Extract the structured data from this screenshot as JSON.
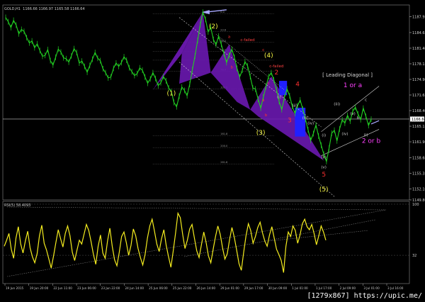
{
  "chart_data": [
    {
      "type": "line",
      "title": "GOLD,H1",
      "header_values": "1166.66 1166.97 1165.58 1166.64",
      "ylim": [
        1149.8,
        1190.4
      ],
      "y_ticks": [
        1187.95,
        1184.65,
        1181.4,
        1178.15,
        1174.9,
        1171.65,
        1168.4,
        1165.15,
        1161.9,
        1158.6,
        1155.35,
        1152.1,
        1149.8
      ],
      "current_price": "1166.64",
      "x_ticks": [
        "19 Jun 2015",
        "19 Jun 20:00",
        "22 Jun 11:00",
        "23 Jun 06:00",
        "23 Jun 22:00",
        "24 Jun 14:00",
        "25 Jun 06:00",
        "25 Jun 22:00",
        "26 Jun 14:00",
        "29 Jun 01:00",
        "29 Jun 17:00",
        "30 Jun 09:00",
        "1 Jul 01:00",
        "1 Jul 17:00",
        "2 Jul 09:00",
        "3 Jul 01:00",
        "3 Jul 16:00"
      ],
      "series": [
        {
          "values": [
            1187.8,
            1186.9,
            1185.7,
            1187.2,
            1186.2,
            1184.4,
            1185.3,
            1184.9,
            1183.6,
            1182.5,
            1182.9,
            1181.5,
            1182.3,
            1180.9,
            1179.7,
            1179.9,
            1181.1,
            1178.8,
            1177.9,
            1179.5,
            1181.2,
            1180.6,
            1179.4,
            1179.2,
            1178.5,
            1179.8,
            1181.3,
            1180.5,
            1178.3,
            1178.7,
            1177.6,
            1176.4,
            1177.8,
            1179.1,
            1180.5,
            1179.3,
            1178.8,
            1177.1,
            1176.3,
            1175.2,
            1175.4,
            1177.2,
            1178.3,
            1177.6,
            1178.4,
            1179.6,
            1178.9,
            1177.3,
            1176.5,
            1175.7,
            1176.1,
            1177.3,
            1176.8,
            1175.4,
            1174.1,
            1175.0,
            1176.3,
            1175.1,
            1173.6,
            1174.2,
            1175.5,
            1174.6,
            1173.1,
            1172.4,
            1170.1,
            1169.2,
            1171.4,
            1173.3,
            1172.6,
            1171.5,
            1173.9,
            1176.9,
            1179.8,
            1183.0,
            1186.3,
            1188.9,
            1187.4,
            1184.8,
            1185.7,
            1183.2,
            1182.1,
            1183.9,
            1182.2,
            1180.3,
            1178.4,
            1179.9,
            1181.2,
            1179.5,
            1177.2,
            1175.4,
            1176.8,
            1178.6,
            1177.7,
            1175.5,
            1173.1,
            1172.9,
            1170.8,
            1168.9,
            1171.2,
            1173.4,
            1175.5,
            1176.3,
            1174.8,
            1172.7,
            1170.3,
            1168.6,
            1171.1,
            1172.9,
            1171.5,
            1169.3,
            1167.8,
            1169.4,
            1170.6,
            1168.7,
            1166.6,
            1164.4,
            1162.2,
            1163.6,
            1165.4,
            1163.1,
            1161.2,
            1159.3,
            1157.8,
            1160.6,
            1163.7,
            1164.3,
            1162.1,
            1164.6,
            1166.5,
            1165.8,
            1167.4,
            1166.2,
            1168.3,
            1169.1,
            1167.7,
            1166.5,
            1168.9,
            1167.2,
            1165.3,
            1166.6
          ],
          "color": "#22d022"
        }
      ],
      "annotations": [
        {
          "text": "(2)",
          "color": "#f5f542",
          "x": 79,
          "y": 1185.5
        },
        {
          "text": "(1)",
          "color": "#f5f542",
          "x": 63,
          "y": 1171.6
        },
        {
          "text": "(3)",
          "color": "#f5f542",
          "x": 97,
          "y": 1163.4
        },
        {
          "text": "(4)",
          "color": "#f5f542",
          "x": 100,
          "y": 1179.5
        },
        {
          "text": "(5)",
          "color": "#f5f542",
          "x": 121,
          "y": 1151.6
        },
        {
          "text": "2",
          "color": "#ff3030",
          "x": 103,
          "y": 1175.9
        },
        {
          "text": "3",
          "color": "#ff3030",
          "x": 108,
          "y": 1166.0
        },
        {
          "text": "4",
          "color": "#ff3030",
          "x": 111,
          "y": 1173.5
        },
        {
          "text": "5",
          "color": "#ff3030",
          "x": 121,
          "y": 1154.7
        },
        {
          "text": "c-failed",
          "color": "#ff4040",
          "x": 92,
          "y": 1182.9
        },
        {
          "text": "c-failed",
          "color": "#ff4040",
          "x": 103,
          "y": 1177.4
        },
        {
          "text": "[ Leading Diagonal ]",
          "color": "#d8d8d8",
          "x": 130,
          "y": 1175.5
        },
        {
          "text": "1 or a",
          "color": "#ff40ff",
          "x": 132,
          "y": 1173.3
        },
        {
          "text": "2 or b",
          "color": "#ff40ff",
          "x": 139,
          "y": 1161.7
        },
        {
          "text": "a",
          "color": "#ff3030",
          "x": 85,
          "y": 1183.5
        },
        {
          "text": "b",
          "color": "#ff3030",
          "x": 86,
          "y": 1177.2
        },
        {
          "text": "c",
          "color": "#ff3030",
          "x": 98,
          "y": 1180.8
        },
        {
          "text": "a",
          "color": "#ff3030",
          "x": 98,
          "y": 1170.3
        },
        {
          "text": "b",
          "color": "#ff3030",
          "x": 99,
          "y": 1167.2
        },
        {
          "text": "c",
          "color": "#ff3030",
          "x": 100,
          "y": 1173.9
        },
        {
          "text": "(i)",
          "color": "#cfcfcf",
          "x": 104,
          "y": 1171.0
        },
        {
          "text": "(ii)",
          "color": "#cfcfcf",
          "x": 110,
          "y": 1169.2
        },
        {
          "text": "(iii)",
          "color": "#cfcfcf",
          "x": 114,
          "y": 1166.6
        },
        {
          "text": "(iv)",
          "color": "#cfcfcf",
          "x": 116,
          "y": 1165.5
        },
        {
          "text": "(v)",
          "color": "#cfcfcf",
          "x": 121,
          "y": 1156.4
        },
        {
          "text": "(i)",
          "color": "#cfcfcf",
          "x": 121,
          "y": 1163.0
        },
        {
          "text": "(ii)",
          "color": "#cfcfcf",
          "x": 121,
          "y": 1158.4
        },
        {
          "text": "(iii)",
          "color": "#cfcfcf",
          "x": 126,
          "y": 1169.5
        },
        {
          "text": "(iv)",
          "color": "#cfcfcf",
          "x": 129,
          "y": 1163.3
        },
        {
          "text": "(v)",
          "color": "#cfcfcf",
          "x": 132,
          "y": 1167.5
        },
        {
          "text": "c",
          "color": "#cfcfcf",
          "x": 137,
          "y": 1170.4
        },
        {
          "text": "b",
          "color": "#cfcfcf",
          "x": 134,
          "y": 1166.6
        },
        {
          "text": "(i)",
          "color": "#cfcfcf",
          "x": 137,
          "y": 1163.1
        }
      ],
      "fib_levels": [
        {
          "text": "0.0",
          "value": 1188.6
        },
        {
          "text": "23.6",
          "value": 1184.9
        },
        {
          "text": "38.2",
          "value": 1182.6
        },
        {
          "text": "50.0",
          "value": 1180.7
        },
        {
          "text": "61.8",
          "value": 1178.9
        },
        {
          "text": "76.4",
          "value": 1176.6
        },
        {
          "text": "100.0",
          "value": 1172.9
        },
        {
          "text": "161.8",
          "value": 1163.2
        },
        {
          "text": "200.0",
          "value": 1160.7
        },
        {
          "text": "261.8",
          "value": 1157.3
        }
      ]
    },
    {
      "type": "line",
      "title": "RSI(5) 58.4093",
      "ylim": [
        0,
        100
      ],
      "y_ticks": [
        {
          "label": "100",
          "value": 100
        },
        {
          "label": "32",
          "value": 32
        }
      ],
      "series": [
        {
          "values": [
            44,
            52,
            61,
            40,
            28,
            55,
            70,
            47,
            35,
            51,
            64,
            42,
            30,
            22,
            34,
            58,
            72,
            48,
            39,
            27,
            15,
            31,
            49,
            66,
            54,
            43,
            61,
            71,
            58,
            36,
            25,
            39,
            52,
            47,
            60,
            73,
            65,
            50,
            33,
            20,
            44,
            59,
            35,
            28,
            51,
            68,
            44,
            26,
            18,
            36,
            57,
            63,
            49,
            32,
            45,
            67,
            58,
            41,
            29,
            19,
            33,
            55,
            71,
            80,
            64,
            47,
            37,
            54,
            66,
            45,
            30,
            16,
            38,
            62,
            88,
            82,
            60,
            41,
            52,
            67,
            73,
            55,
            38,
            29,
            46,
            63,
            49,
            31,
            22,
            40,
            57,
            71,
            60,
            42,
            27,
            34,
            53,
            69,
            56,
            39,
            21,
            12,
            36,
            58,
            74,
            65,
            48,
            57,
            69,
            76,
            62,
            51,
            44,
            59,
            70,
            55,
            40,
            33,
            25,
            9,
            44,
            63,
            57,
            71,
            65,
            48,
            59,
            74,
            80,
            70,
            66,
            73,
            61,
            46,
            58,
            71,
            63,
            52
          ],
          "color": "#f5ed1f"
        }
      ]
    }
  ],
  "footer": {
    "text": "[1279x867] https://upic.me/"
  }
}
